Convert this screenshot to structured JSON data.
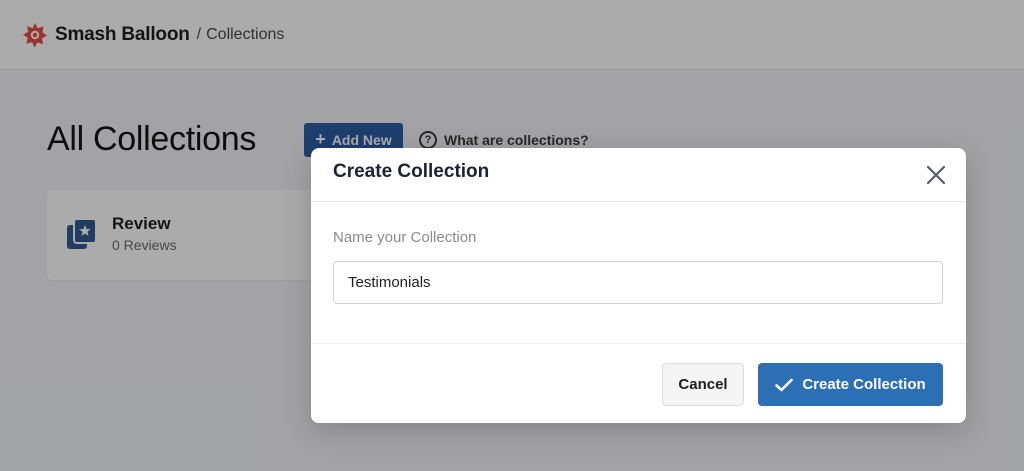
{
  "header": {
    "brand": "Smash Balloon",
    "separator": "/",
    "breadcrumb": "Collections"
  },
  "page": {
    "title": "All Collections",
    "add_new_label": "Add New",
    "help_label": "What are collections?",
    "help_icon_glyph": "?"
  },
  "collections": [
    {
      "title": "Review",
      "subtitle": "0 Reviews"
    }
  ],
  "modal": {
    "title": "Create Collection",
    "field_label": "Name your Collection",
    "field_value": "Testimonials",
    "cancel_label": "Cancel",
    "create_label": "Create Collection"
  },
  "icons": {
    "brand": "smash-balloon-logo-icon",
    "add": "plus-icon",
    "help": "question-circle-icon",
    "collection": "review-collection-icon",
    "close": "close-icon",
    "create": "checkmark-icon"
  },
  "colors": {
    "brand_red": "#e34f44",
    "primary_blue": "#2d6fb4",
    "add_new_blue": "#2c5ea8",
    "collection_icon_blue": "#2f5b8f",
    "overlay": "rgba(0,0,0,0.33)"
  }
}
